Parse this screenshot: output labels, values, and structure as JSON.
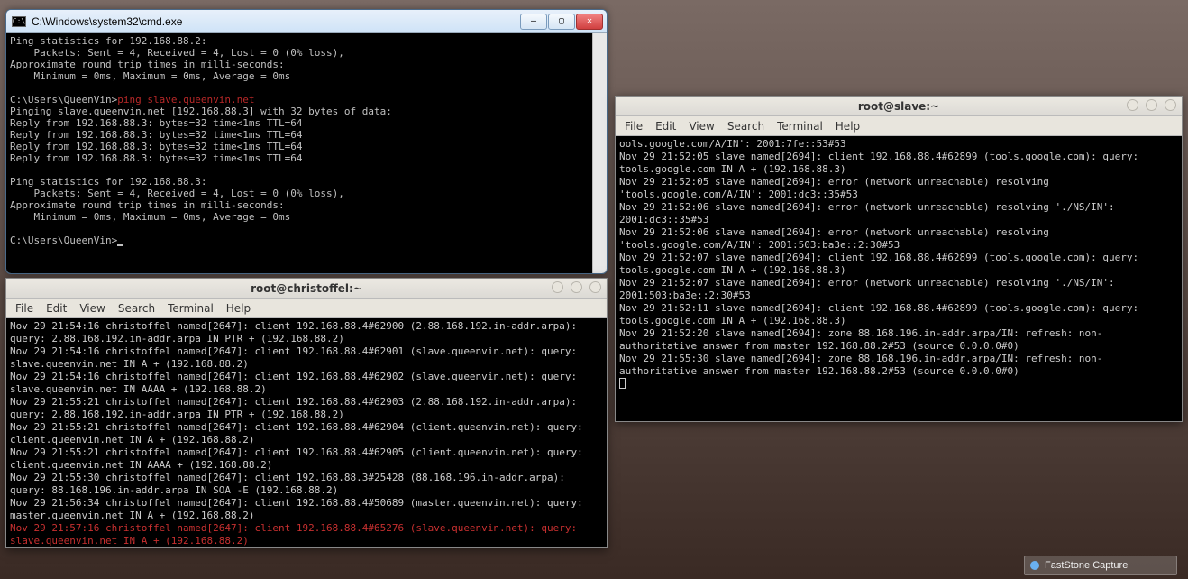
{
  "cmd": {
    "title": "C:\\Windows\\system32\\cmd.exe",
    "lines": [
      "Ping statistics for 192.168.88.2:",
      "    Packets: Sent = 4, Received = 4, Lost = 0 (0% loss),",
      "Approximate round trip times in milli-seconds:",
      "    Minimum = 0ms, Maximum = 0ms, Average = 0ms",
      "",
      "C:\\Users\\QueenVin>"
    ],
    "highlight": "ping slave.queenvin.net",
    "lines2": [
      "",
      "Pinging slave.queenvin.net [192.168.88.3] with 32 bytes of data:",
      "Reply from 192.168.88.3: bytes=32 time<1ms TTL=64",
      "Reply from 192.168.88.3: bytes=32 time<1ms TTL=64",
      "Reply from 192.168.88.3: bytes=32 time<1ms TTL=64",
      "Reply from 192.168.88.3: bytes=32 time<1ms TTL=64",
      "",
      "Ping statistics for 192.168.88.3:",
      "    Packets: Sent = 4, Received = 4, Lost = 0 (0% loss),",
      "Approximate round trip times in milli-seconds:",
      "    Minimum = 0ms, Maximum = 0ms, Average = 0ms",
      "",
      "C:\\Users\\QueenVin>"
    ]
  },
  "menu": {
    "file": "File",
    "edit": "Edit",
    "view": "View",
    "search": "Search",
    "terminal": "Terminal",
    "help": "Help"
  },
  "christoffel": {
    "title": "root@christoffel:~",
    "lines": [
      "Nov 29 21:54:16 christoffel named[2647]: client 192.168.88.4#62900 (2.88.168.192.in-addr.arpa): query: 2.88.168.192.in-addr.arpa IN PTR + (192.168.88.2)",
      "Nov 29 21:54:16 christoffel named[2647]: client 192.168.88.4#62901 (slave.queenvin.net): query: slave.queenvin.net IN A + (192.168.88.2)",
      "Nov 29 21:54:16 christoffel named[2647]: client 192.168.88.4#62902 (slave.queenvin.net): query: slave.queenvin.net IN AAAA + (192.168.88.2)",
      "Nov 29 21:55:21 christoffel named[2647]: client 192.168.88.4#62903 (2.88.168.192.in-addr.arpa): query: 2.88.168.192.in-addr.arpa IN PTR + (192.168.88.2)",
      "Nov 29 21:55:21 christoffel named[2647]: client 192.168.88.4#62904 (client.queenvin.net): query: client.queenvin.net IN A + (192.168.88.2)",
      "Nov 29 21:55:21 christoffel named[2647]: client 192.168.88.4#62905 (client.queenvin.net): query: client.queenvin.net IN AAAA + (192.168.88.2)",
      "Nov 29 21:55:30 christoffel named[2647]: client 192.168.88.3#25428 (88.168.196.in-addr.arpa): query: 88.168.196.in-addr.arpa IN SOA -E (192.168.88.2)",
      "Nov 29 21:56:34 christoffel named[2647]: client 192.168.88.4#50689 (master.queenvin.net): query: master.queenvin.net IN A + (192.168.88.2)"
    ],
    "errline": "Nov 29 21:57:16 christoffel named[2647]: client 192.168.88.4#65276 (slave.queenvin.net): query: slave.queenvin.net IN A + (192.168.88.2)"
  },
  "slave": {
    "title": "root@slave:~",
    "lines": [
      "ools.google.com/A/IN': 2001:7fe::53#53",
      "Nov 29 21:52:05 slave named[2694]: client 192.168.88.4#62899 (tools.google.com): query: tools.google.com IN A + (192.168.88.3)",
      "Nov 29 21:52:05 slave named[2694]: error (network unreachable) resolving 'tools.google.com/A/IN': 2001:dc3::35#53",
      "Nov 29 21:52:06 slave named[2694]: error (network unreachable) resolving './NS/IN': 2001:dc3::35#53",
      "Nov 29 21:52:06 slave named[2694]: error (network unreachable) resolving 'tools.google.com/A/IN': 2001:503:ba3e::2:30#53",
      "Nov 29 21:52:07 slave named[2694]: client 192.168.88.4#62899 (tools.google.com): query: tools.google.com IN A + (192.168.88.3)",
      "Nov 29 21:52:07 slave named[2694]: error (network unreachable) resolving './NS/IN': 2001:503:ba3e::2:30#53",
      "Nov 29 21:52:11 slave named[2694]: client 192.168.88.4#62899 (tools.google.com): query: tools.google.com IN A + (192.168.88.3)",
      "Nov 29 21:52:20 slave named[2694]: zone 88.168.196.in-addr.arpa/IN: refresh: non-authoritative answer from master 192.168.88.2#53 (source 0.0.0.0#0)",
      "Nov 29 21:55:30 slave named[2694]: zone 88.168.196.in-addr.arpa/IN: refresh: non-authoritative answer from master 192.168.88.2#53 (source 0.0.0.0#0)"
    ]
  },
  "taskbar": {
    "label": "FastStone Capture"
  }
}
